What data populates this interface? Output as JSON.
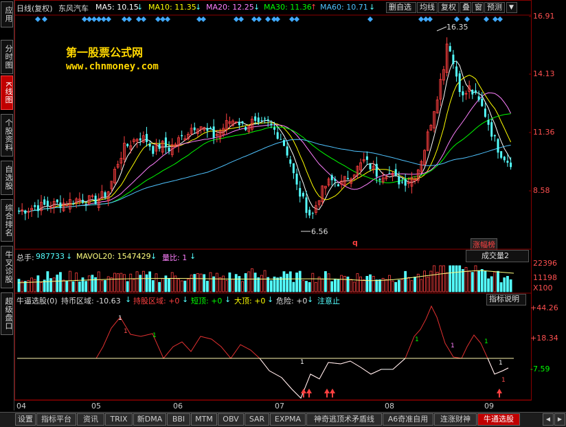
{
  "left_tabs": [
    {
      "label": "应用",
      "active": false
    },
    {
      "label": "分时图",
      "active": false
    },
    {
      "label": "K线图",
      "active": true
    },
    {
      "label": "个股资料",
      "active": false
    },
    {
      "label": "自选股",
      "active": false
    },
    {
      "label": "综合排名",
      "active": false
    },
    {
      "label": "牛叉诊股",
      "active": false
    },
    {
      "label": "超级盘口",
      "active": false
    }
  ],
  "header": {
    "chart_type": "日线(复权)",
    "stock_name": "东风汽车",
    "ma5": "MA5: 10.15",
    "ma10": "MA10: 11.35",
    "ma20": "MA20: 12.25",
    "ma30": "MA30: 11.36",
    "ma60": "MA60: 10.71",
    "arrow_down": "↓",
    "arrow_up": "↑",
    "buttons": [
      "删自选",
      "均线",
      "复权",
      "叠",
      "窗",
      "预测"
    ],
    "menu_arrow": "▼"
  },
  "colors": {
    "ma5": "#ffffff",
    "ma10": "#ffff00",
    "ma20": "#ff80ff",
    "ma30": "#00ff00",
    "ma60": "#4fc3ff",
    "up": "#ff4040",
    "down": "#54ffff",
    "frame": "#8b0000"
  },
  "watermark": {
    "line1": "第一股票公式网",
    "line2": "www.chnmoney.com"
  },
  "price_axis": [
    "16.91",
    "14.13",
    "11.36",
    "8.58"
  ],
  "price_annotations": {
    "high": "16.35",
    "low": "6.56",
    "marker_q": "q",
    "badge": "涨幅榜"
  },
  "volume": {
    "label": "总手: ",
    "total": "987733",
    "mavol": "MAVOL20: 1547429",
    "ratio": "量比: 1",
    "dropdown": "成交量2",
    "axis": [
      "22396",
      "11198",
      "X100"
    ]
  },
  "indicator": {
    "name": "牛逼选股(0)",
    "hold": "持币区域: -10.63",
    "hold_stock": "持股区域: +0",
    "short_top": "短顶: +0",
    "big_top": "大顶: +0",
    "danger": "危险: +0",
    "attention": "注意止",
    "help_button": "指标说明",
    "axis": [
      "+44.26",
      "+18.34",
      "-7.59"
    ]
  },
  "x_axis": [
    "04",
    "05",
    "06",
    "07",
    "08",
    "09"
  ],
  "bottom_tabs": [
    "设置",
    "指标平台",
    "资讯",
    "TRIX",
    "新DMA",
    "BBI",
    "MTM",
    "OBV",
    "SAR",
    "EXPMA",
    "神奇逃顶术矛盾线",
    "A6奇准自用",
    "连涨财神",
    "牛通选股"
  ],
  "bottom_active": "牛通选股"
}
